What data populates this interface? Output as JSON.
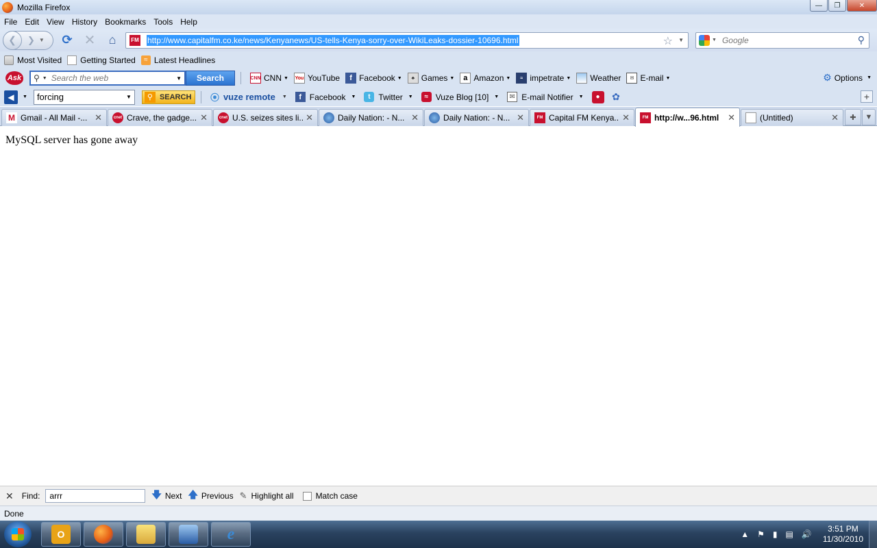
{
  "window": {
    "title": "Mozilla Firefox"
  },
  "menubar": {
    "items": [
      {
        "label": "File",
        "key": "F",
        "rest": "ile"
      },
      {
        "label": "Edit",
        "key": "E",
        "rest": "dit"
      },
      {
        "label": "View",
        "key": "V",
        "rest": "iew"
      },
      {
        "label": "History",
        "key": "",
        "rest": "History"
      },
      {
        "label": "Bookmarks",
        "key": "B",
        "rest": "ookmarks"
      },
      {
        "label": "Tools",
        "key": "T",
        "rest": "ools"
      },
      {
        "label": "Help",
        "key": "H",
        "rest": "elp"
      }
    ]
  },
  "navbar": {
    "url": "http://www.capitalfm.co.ke/news/Kenyanews/US-tells-Kenya-sorry-over-WikiLeaks-dossier-10696.html",
    "search_placeholder": "Google"
  },
  "bookmarks": {
    "items": [
      "Most Visited",
      "Getting Started",
      "Latest Headlines"
    ]
  },
  "ask_toolbar": {
    "placeholder": "Search the web",
    "search_label": "Search",
    "buttons": [
      "CNN",
      "YouTube",
      "Facebook",
      "Games",
      "Amazon",
      "impetrate",
      "Weather",
      "E-mail"
    ],
    "options_label": "Options"
  },
  "vuze_toolbar": {
    "query": "forcing",
    "search_label": "SEARCH",
    "remote_label": "vuze remote",
    "buttons": [
      "Facebook",
      "Twitter",
      "Vuze Blog [10]",
      "E-mail Notifier"
    ]
  },
  "tabs": [
    {
      "label": "Gmail - All Mail -...",
      "icon": "gmail"
    },
    {
      "label": "Crave, the gadge...",
      "icon": "cnet"
    },
    {
      "label": "U.S. seizes sites li...",
      "icon": "cnet"
    },
    {
      "label": "Daily Nation: - N...",
      "icon": "nation"
    },
    {
      "label": "Daily Nation: - N...",
      "icon": "nation"
    },
    {
      "label": "Capital FM Kenya...",
      "icon": "capfm"
    },
    {
      "label": "http://w...96.html",
      "icon": "capfm",
      "active": true
    },
    {
      "label": "(Untitled)",
      "icon": "blank"
    }
  ],
  "content": {
    "message": "MySQL server has gone away"
  },
  "findbar": {
    "label": "Find:",
    "query": "arrr",
    "next": "Next",
    "previous": "Previous",
    "highlight": "Highlight all",
    "match_case": "Match case"
  },
  "status": {
    "text": "Done"
  },
  "taskbar": {
    "time": "3:51 PM",
    "date": "11/30/2010"
  }
}
